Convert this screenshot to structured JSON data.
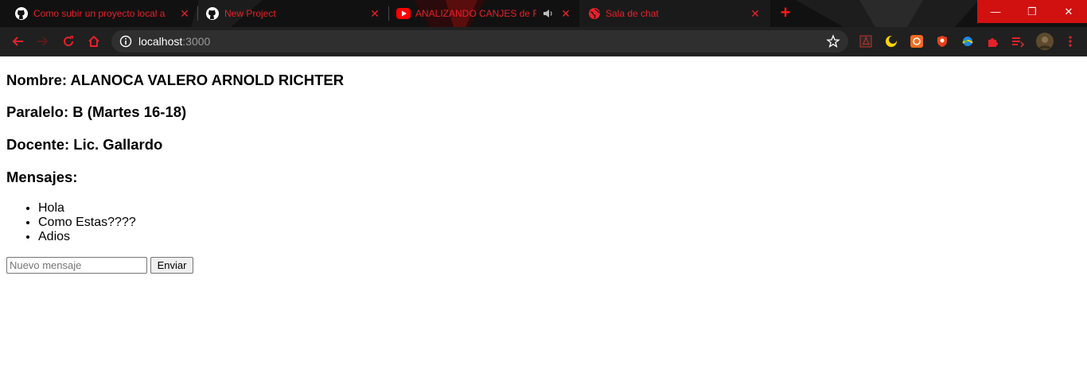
{
  "browser": {
    "tabs": [
      {
        "title": "Como subir un proyecto local a github",
        "icon": "github-icon"
      },
      {
        "title": "New Project",
        "icon": "github-icon"
      },
      {
        "title": "ANALIZANDO CANJES de FALCAO",
        "icon": "youtube-icon",
        "audio": "speaker-icon"
      },
      {
        "title": "Sala de chat",
        "icon": "globe-icon"
      }
    ],
    "new_tab": "+",
    "window": {
      "minimize": "—",
      "restore": "❐",
      "close": "✕"
    },
    "address": {
      "host": "localhost",
      "port": ":3000"
    },
    "accent_color": "#e8202a"
  },
  "page": {
    "nombre": "Nombre: ALANOCA VALERO ARNOLD RICHTER",
    "paralelo": "Paralelo: B (Martes 16-18)",
    "docente": "Docente: Lic. Gallardo",
    "mensajes_heading": "Mensajes:",
    "messages": [
      "Hola",
      "Como Estas????",
      "Adios"
    ],
    "input_placeholder": "Nuevo mensaje",
    "send_label": "Enviar"
  }
}
